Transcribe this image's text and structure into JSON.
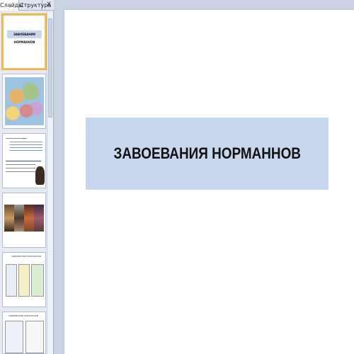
{
  "panel": {
    "tabs": {
      "slides": "Слайды",
      "outline": "Структура",
      "close": "X"
    }
  },
  "slide": {
    "title": "ЗАВОЕВАНИЯ НОРМАННОВ"
  },
  "thumbnails": {
    "t1_title": "ЗАВОЕВАНИЯ НОРМАННОВ",
    "t5_title": "ЗАВОЕВАНИЯ НОРМАННОВ",
    "t6_title": "ЗАВОЕВАНИЯ НОРМАННОВ"
  },
  "colors": {
    "title_box": "#c6d7ee",
    "selected_border": "#f0c060",
    "workspace": "#c9d3e2"
  }
}
